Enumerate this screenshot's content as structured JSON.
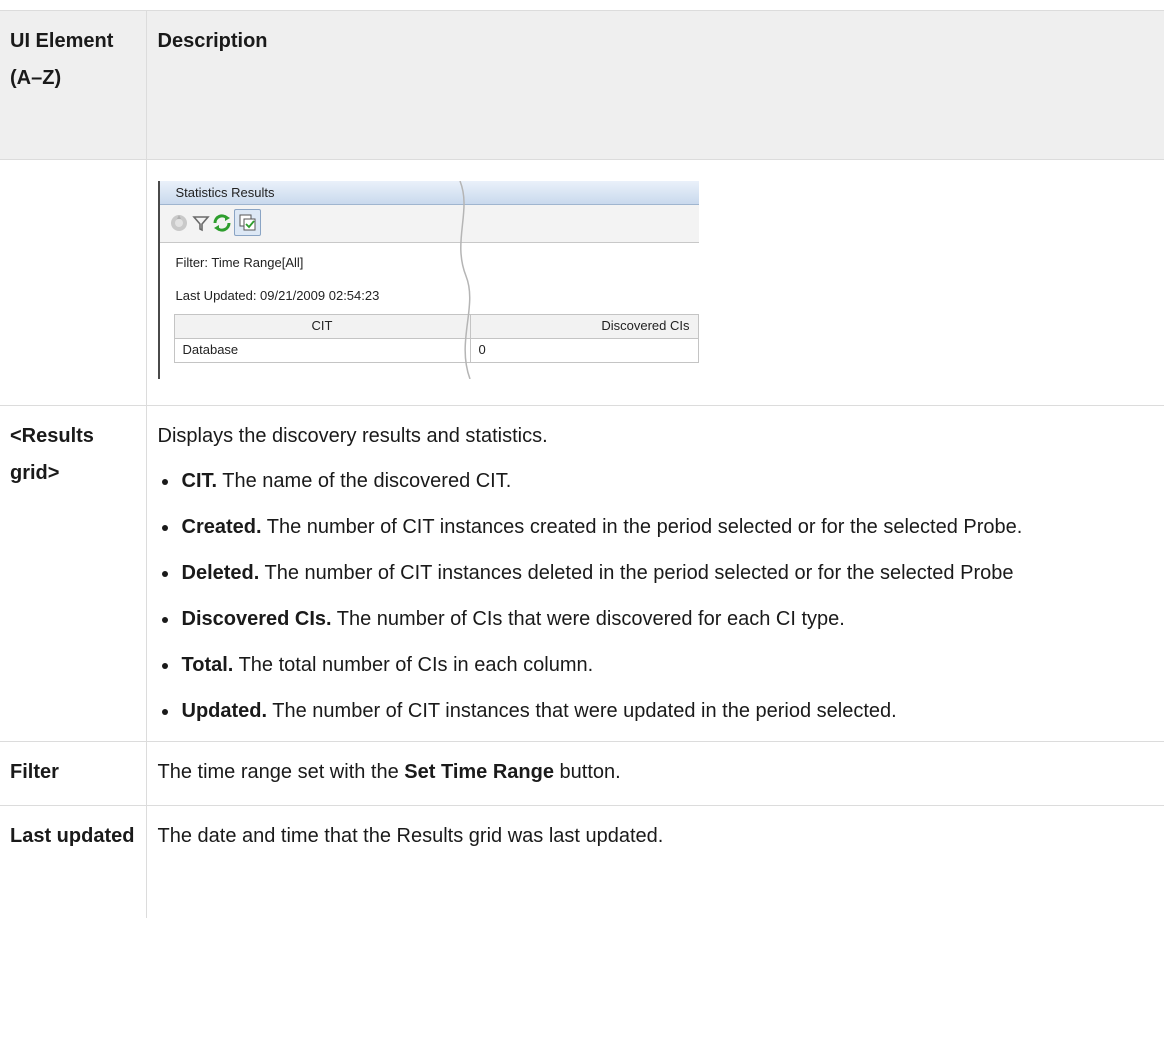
{
  "table": {
    "headers": [
      "UI Element (A–Z)",
      "Description"
    ],
    "rows": [
      {
        "name": "<Results grid>",
        "intro": "Displays the discovery results and statistics.",
        "bullets": [
          {
            "term": "CIT.",
            "text": "The name of the discovered CIT."
          },
          {
            "term": "Created.",
            "text": "The number of CIT instances created in the period selected or for the selected Probe."
          },
          {
            "term": "Deleted.",
            "text": "The number of CIT instances deleted in the period selected or for the selected Probe"
          },
          {
            "term": "Discovered CIs.",
            "text": "The number of CIs that were discovered for each CI type."
          },
          {
            "term": "Total.",
            "text": "The total number of CIs in each column."
          },
          {
            "term": "Updated.",
            "text": "The number of CIT instances that were updated in the period selected."
          }
        ]
      },
      {
        "name": "Filter",
        "desc_before": "The time range set with the ",
        "desc_bold": "Set Time Range",
        "desc_after": " button."
      },
      {
        "name": "Last updated",
        "desc": "The date and time that the Results grid was last updated."
      }
    ]
  },
  "screenshot": {
    "title": "Statistics Results",
    "filter_text": "Filter: Time Range[All]",
    "last_updated_text": "Last Updated: 09/21/2009 02:54:23",
    "columns": [
      "CIT",
      "Discovered CIs"
    ],
    "row": [
      "Database",
      "0"
    ],
    "icons": [
      "discovery-progress-icon",
      "filter-icon",
      "refresh-icon",
      "select-cits-toggle-icon"
    ],
    "colors": {
      "title_bar": "#c9d9ed",
      "refresh": "#2e9e2e",
      "filter": "#6a6a6a"
    }
  }
}
